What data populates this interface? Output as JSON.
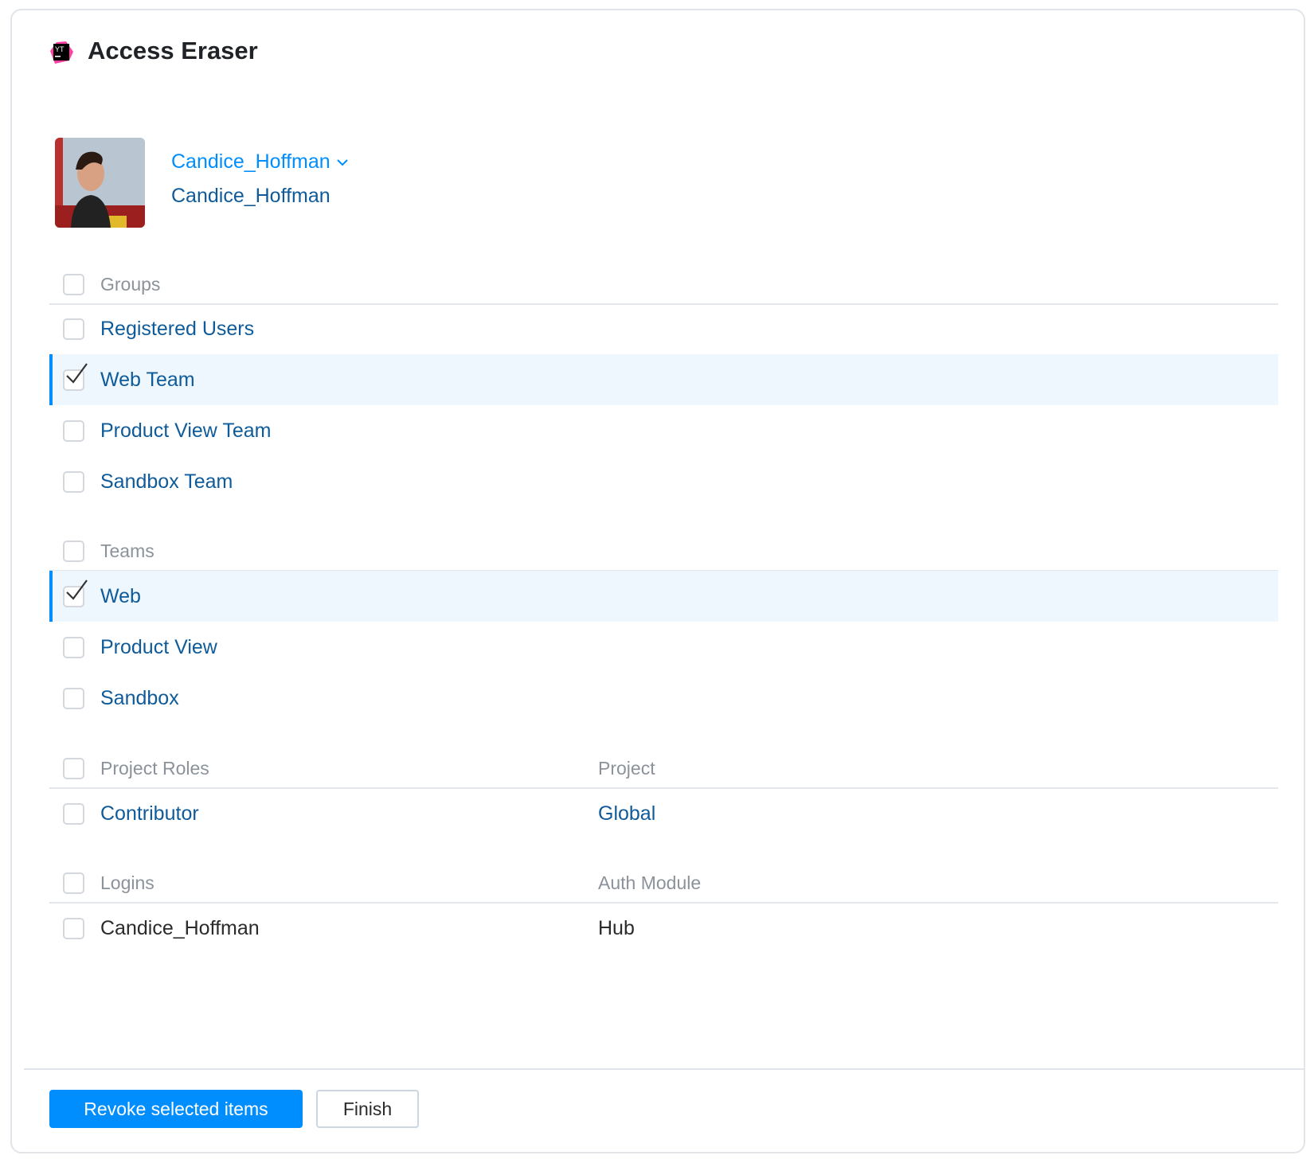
{
  "header": {
    "title": "Access Eraser",
    "logo_text": "YT"
  },
  "user": {
    "selector_name": "Candice_Hoffman",
    "login": "Candice_Hoffman"
  },
  "groups": {
    "header": "Groups",
    "items": [
      {
        "label": "Registered Users",
        "checked": false
      },
      {
        "label": "Web Team",
        "checked": true
      },
      {
        "label": "Product View Team",
        "checked": false
      },
      {
        "label": "Sandbox Team",
        "checked": false
      }
    ]
  },
  "teams": {
    "header": "Teams",
    "items": [
      {
        "label": "Web",
        "checked": true
      },
      {
        "label": "Product View",
        "checked": false
      },
      {
        "label": "Sandbox",
        "checked": false
      }
    ]
  },
  "project_roles": {
    "header": "Project Roles",
    "col2_header": "Project",
    "items": [
      {
        "label": "Contributor",
        "project": "Global",
        "checked": false
      }
    ]
  },
  "logins": {
    "header": "Logins",
    "col2_header": "Auth Module",
    "items": [
      {
        "label": "Candice_Hoffman",
        "module": "Hub",
        "checked": false
      }
    ]
  },
  "footer": {
    "revoke_label": "Revoke selected items",
    "finish_label": "Finish"
  },
  "colors": {
    "accent": "#008eff",
    "link": "#0f5b9a",
    "selected_bg": "#eef6fe"
  }
}
